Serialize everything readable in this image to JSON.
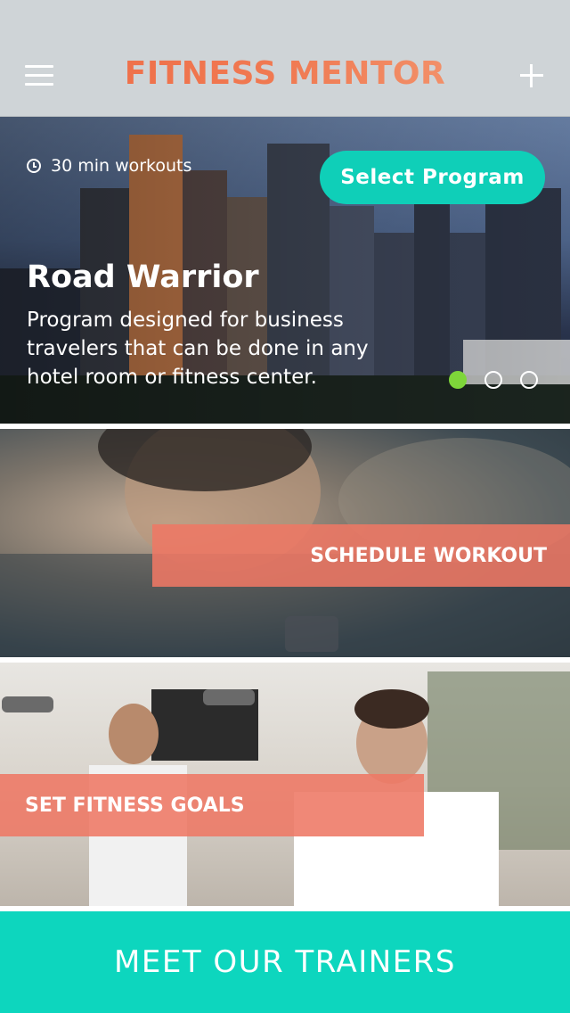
{
  "header": {
    "title": "FITNESS MENTOR",
    "menu_icon": "hamburger-menu-icon",
    "add_icon": "plus-icon"
  },
  "hero": {
    "duration_icon": "clock-icon",
    "duration": "30 min workouts",
    "select_label": "Select Program",
    "title": "Road Warrior",
    "description": "Program designed for business travelers that can be done in any hotel room or fitness center.",
    "carousel": {
      "total": 3,
      "active_index": 0
    }
  },
  "actions": {
    "schedule_label": "SCHEDULE WORKOUT",
    "goals_label": "SET FITNESS GOALS"
  },
  "footer": {
    "trainers_label": "MEET OUR TRAINERS"
  },
  "colors": {
    "header_bg": "#cfd4d7",
    "title_orange": "#ee6a45",
    "accent_teal": "#0fcfb8",
    "band_salmon": "#ee7864",
    "active_dot": "#7ed63a"
  }
}
